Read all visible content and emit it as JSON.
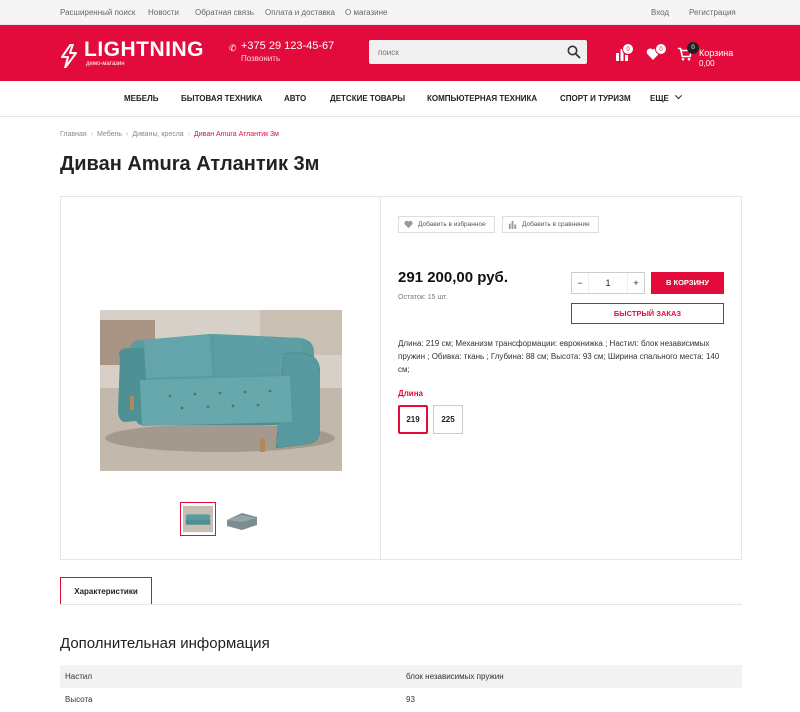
{
  "topbar": {
    "links": [
      "Расширенный поиск",
      "Новости",
      "Обратная связь",
      "Оплата и доставка",
      "О магазине"
    ],
    "login": "Вход",
    "register": "Регистрация"
  },
  "header": {
    "logo": "LIGHTNING",
    "logo_sub": "демо-магазин",
    "phone": "+375 29 123-45-67",
    "callback": "Позвонить",
    "search_placeholder": "поиск",
    "compare_count": "0",
    "favorites_count": "0",
    "cart_count": "0",
    "cart_label": "Корзина",
    "cart_total": "0,00"
  },
  "nav": {
    "items": [
      "МЕБЕЛЬ",
      "БЫТОВАЯ ТЕХНИКА",
      "АВТО",
      "ДЕТСКИЕ ТОВАРЫ",
      "КОМПЬЮТЕРНАЯ ТЕХНИКА",
      "СПОРТ И ТУРИЗМ"
    ],
    "more": "ЕЩЕ"
  },
  "breadcrumb": {
    "items": [
      "Главная",
      "Мебель",
      "Диваны, кресла"
    ],
    "current": "Диван Amura Атлантик 3м"
  },
  "product": {
    "title": "Диван Amura Атлантик 3м",
    "add_favorite": "Добавить в избранное",
    "add_compare": "Добавить в сравнение",
    "price": "291 200,00 руб.",
    "stock": "Остаток: 15 шт.",
    "qty_minus": "−",
    "qty_value": "1",
    "qty_plus": "+",
    "cart_button": "В КОРЗИНУ",
    "quick_order": "БЫСТРЫЙ ЗАКАЗ",
    "description": "Длина: 219 см; Механизм трансформации: еврокнижка ; Настил: блок независимых пружин ; Обивка: ткань ; Глубина: 88 см; Высота: 93 см; Ширина спального места: 140 см;",
    "option_label": "Длина",
    "options": [
      "219",
      "225"
    ],
    "selected_option": "219"
  },
  "tabs": {
    "active": "Характеристики"
  },
  "info": {
    "title": "Дополнительная информация",
    "rows": [
      {
        "name": "Настил",
        "value": "блок независимых пружин"
      },
      {
        "name": "Высота",
        "value": "93"
      }
    ]
  },
  "colors": {
    "accent": "#e30b3c",
    "sofa": "#5f9ea3"
  }
}
